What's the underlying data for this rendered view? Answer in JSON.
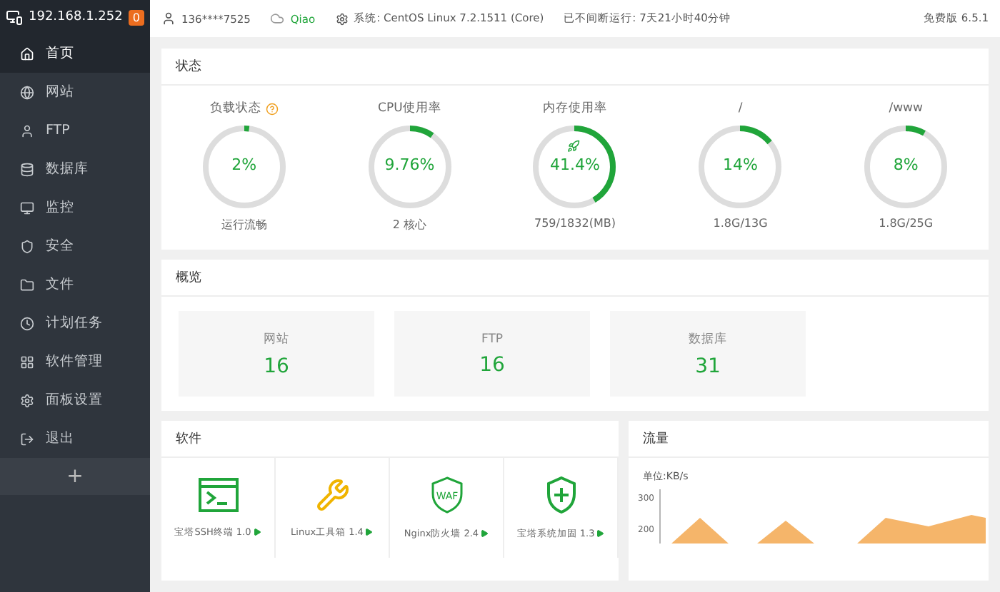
{
  "sidebar": {
    "host": "192.168.1.252",
    "badge": "0",
    "items": [
      {
        "label": "首页",
        "selected": true
      },
      {
        "label": "网站",
        "selected": false
      },
      {
        "label": "FTP",
        "selected": false
      },
      {
        "label": "数据库",
        "selected": false
      },
      {
        "label": "监控",
        "selected": false
      },
      {
        "label": "安全",
        "selected": false
      },
      {
        "label": "文件",
        "selected": false
      },
      {
        "label": "计划任务",
        "selected": false
      },
      {
        "label": "软件管理",
        "selected": false
      },
      {
        "label": "面板设置",
        "selected": false
      },
      {
        "label": "退出",
        "selected": false
      }
    ],
    "add": "+"
  },
  "topbar": {
    "user": "136****7525",
    "cloud_user": "Qiao",
    "system": "系统: CentOS Linux 7.2.1511 (Core)",
    "uptime": "已不间断运行: 7天21小时40分钟",
    "version": "免费版 6.5.1"
  },
  "status": {
    "title": "状态",
    "gauges": [
      {
        "kind": "load",
        "label": "负载状态",
        "value": "2%",
        "sub": "运行流畅",
        "level": 0.02
      },
      {
        "kind": "cpu",
        "label": "CPU使用率",
        "value": "9.76%",
        "sub": "2 核心",
        "level": 0.0976
      },
      {
        "kind": "memory",
        "label": "内存使用率",
        "value": "41.4%",
        "sub": "759/1832(MB)",
        "level": 0.414
      },
      {
        "kind": "disk",
        "label": "/",
        "value": "14%",
        "sub": "1.8G/13G",
        "level": 0.14
      },
      {
        "kind": "disk",
        "label": "/www",
        "value": "8%",
        "sub": "1.8G/25G",
        "level": 0.08
      }
    ]
  },
  "overview": {
    "title": "概览",
    "cards": [
      {
        "label": "网站",
        "value": "16"
      },
      {
        "label": "FTP",
        "value": "16"
      },
      {
        "label": "数据库",
        "value": "31"
      }
    ]
  },
  "software": {
    "title": "软件",
    "items": [
      {
        "kind": "terminal",
        "name": "宝塔SSH终端 1.0"
      },
      {
        "kind": "tools",
        "name": "Linux工具箱 1.4"
      },
      {
        "kind": "waf",
        "name": "Nginx防火墙 2.4",
        "icon_text": "WAF"
      },
      {
        "kind": "shield",
        "name": "宝塔系统加固 1.3"
      }
    ]
  },
  "traffic": {
    "title": "流量",
    "unit": "单位:KB/s",
    "yticks": [
      "300",
      "200"
    ]
  }
}
